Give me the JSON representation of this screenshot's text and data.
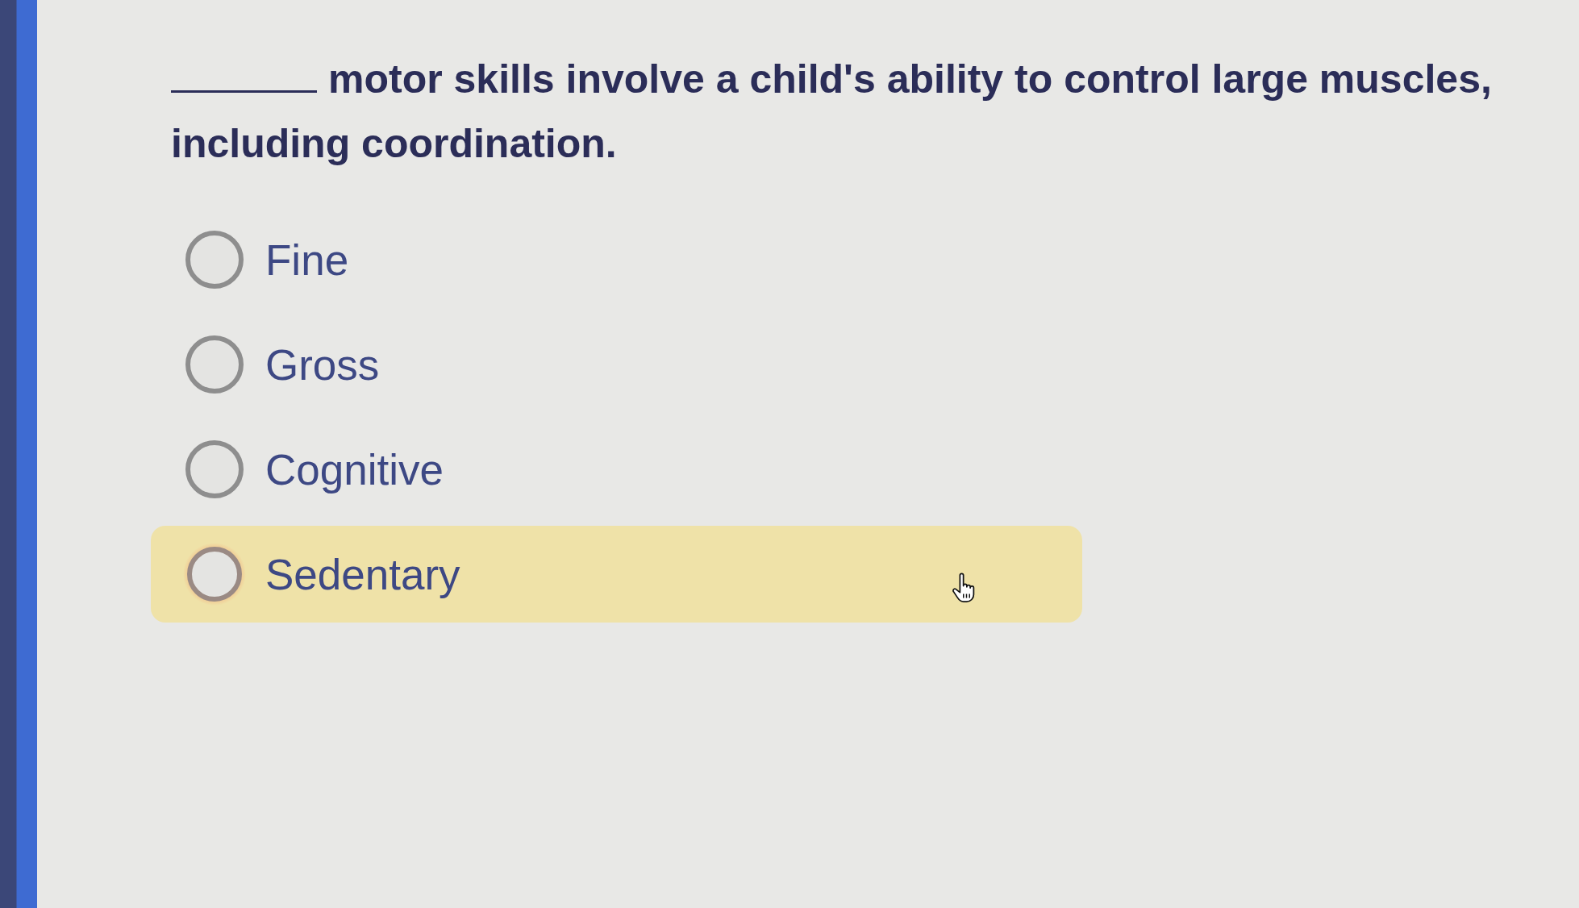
{
  "question": {
    "parts": [
      {
        "kind": "blank"
      },
      {
        "kind": "text",
        "text": "motor skills involve a child's ability to control large muscles, including coordination."
      }
    ]
  },
  "options": [
    {
      "label": "Fine",
      "selected": false,
      "highlighted": false
    },
    {
      "label": "Gross",
      "selected": false,
      "highlighted": false
    },
    {
      "label": "Cognitive",
      "selected": false,
      "highlighted": false
    },
    {
      "label": "Sedentary",
      "selected": false,
      "highlighted": true
    }
  ]
}
